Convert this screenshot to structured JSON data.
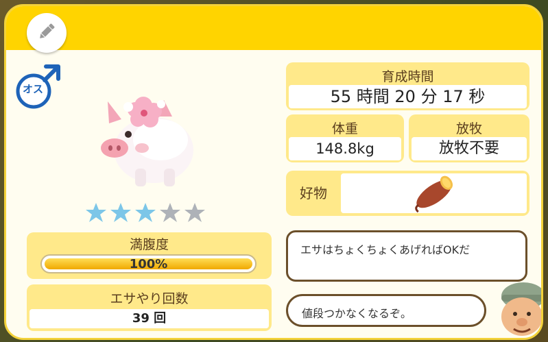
{
  "gender": {
    "symbol_text": "オス",
    "icon": "male-icon"
  },
  "stars": {
    "rating": 3,
    "max": 5,
    "filled_color": "#7cc6e8",
    "empty_color": "#aeb2b8"
  },
  "fullness": {
    "label": "満腹度",
    "value_text": "100%",
    "percent": 100
  },
  "feed_count": {
    "label": "エサやり回数",
    "value": "39 回"
  },
  "growth_time": {
    "label": "育成時間",
    "value": "55 時間 20 分 17 秒"
  },
  "weight": {
    "label": "体重",
    "value": "148.8kg"
  },
  "grazing": {
    "label": "放牧",
    "value": "放牧不要"
  },
  "favorite": {
    "label": "好物",
    "item_icon": "sweet-potato-icon"
  },
  "dialogue": {
    "line1": "エサはちょくちょくあげればOKだ",
    "line2": "値段つかなくなるぞ。"
  },
  "colors": {
    "header": "#ffd400",
    "card": "#ffe98a",
    "male_blue": "#1e63b8"
  }
}
